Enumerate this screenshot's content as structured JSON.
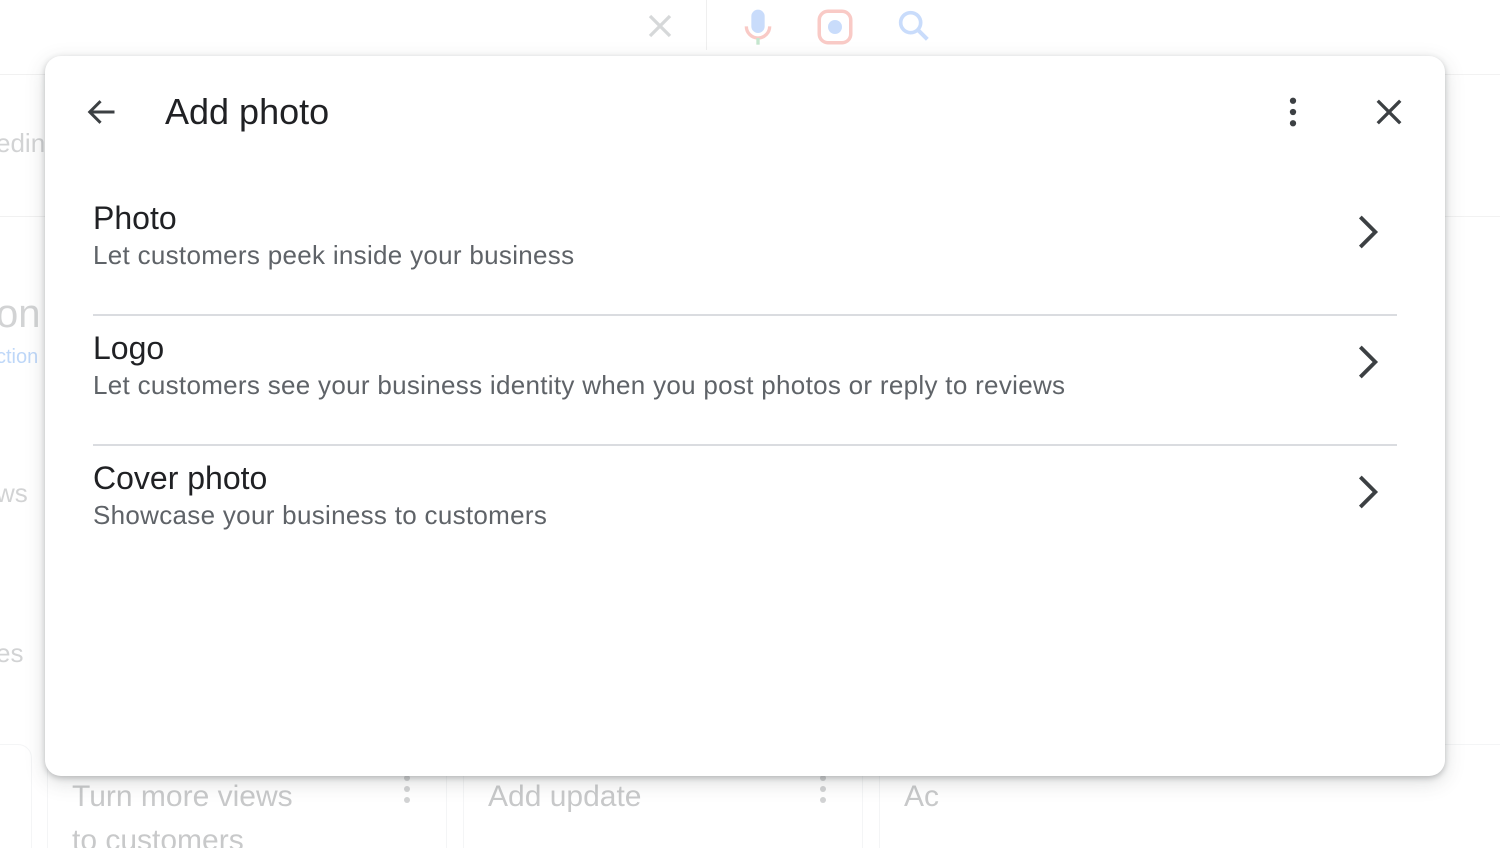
{
  "background": {
    "left_fragments": [
      "edin",
      "on",
      "ction",
      "ws",
      "es"
    ],
    "cards": [
      {
        "text_line1": "Turn more views",
        "text_line2": "to customers"
      },
      {
        "text_line1": "Add update",
        "text_line2": ""
      },
      {
        "text_line1": "Ac",
        "text_line2": ""
      }
    ]
  },
  "dialog": {
    "title": "Add photo",
    "back_icon": "arrow-back-icon",
    "more_icon": "more-vert-icon",
    "close_icon": "close-icon",
    "options": [
      {
        "title": "Photo",
        "description": "Let customers peek inside your business"
      },
      {
        "title": "Logo",
        "description": "Let customers see your business identity when you post photos or reply to reviews"
      },
      {
        "title": "Cover photo",
        "description": "Showcase your business to customers"
      }
    ]
  },
  "colors": {
    "title_text": "#202124",
    "secondary_text": "#5f6368",
    "divider": "#dadce0",
    "icon": "#3c4043"
  }
}
